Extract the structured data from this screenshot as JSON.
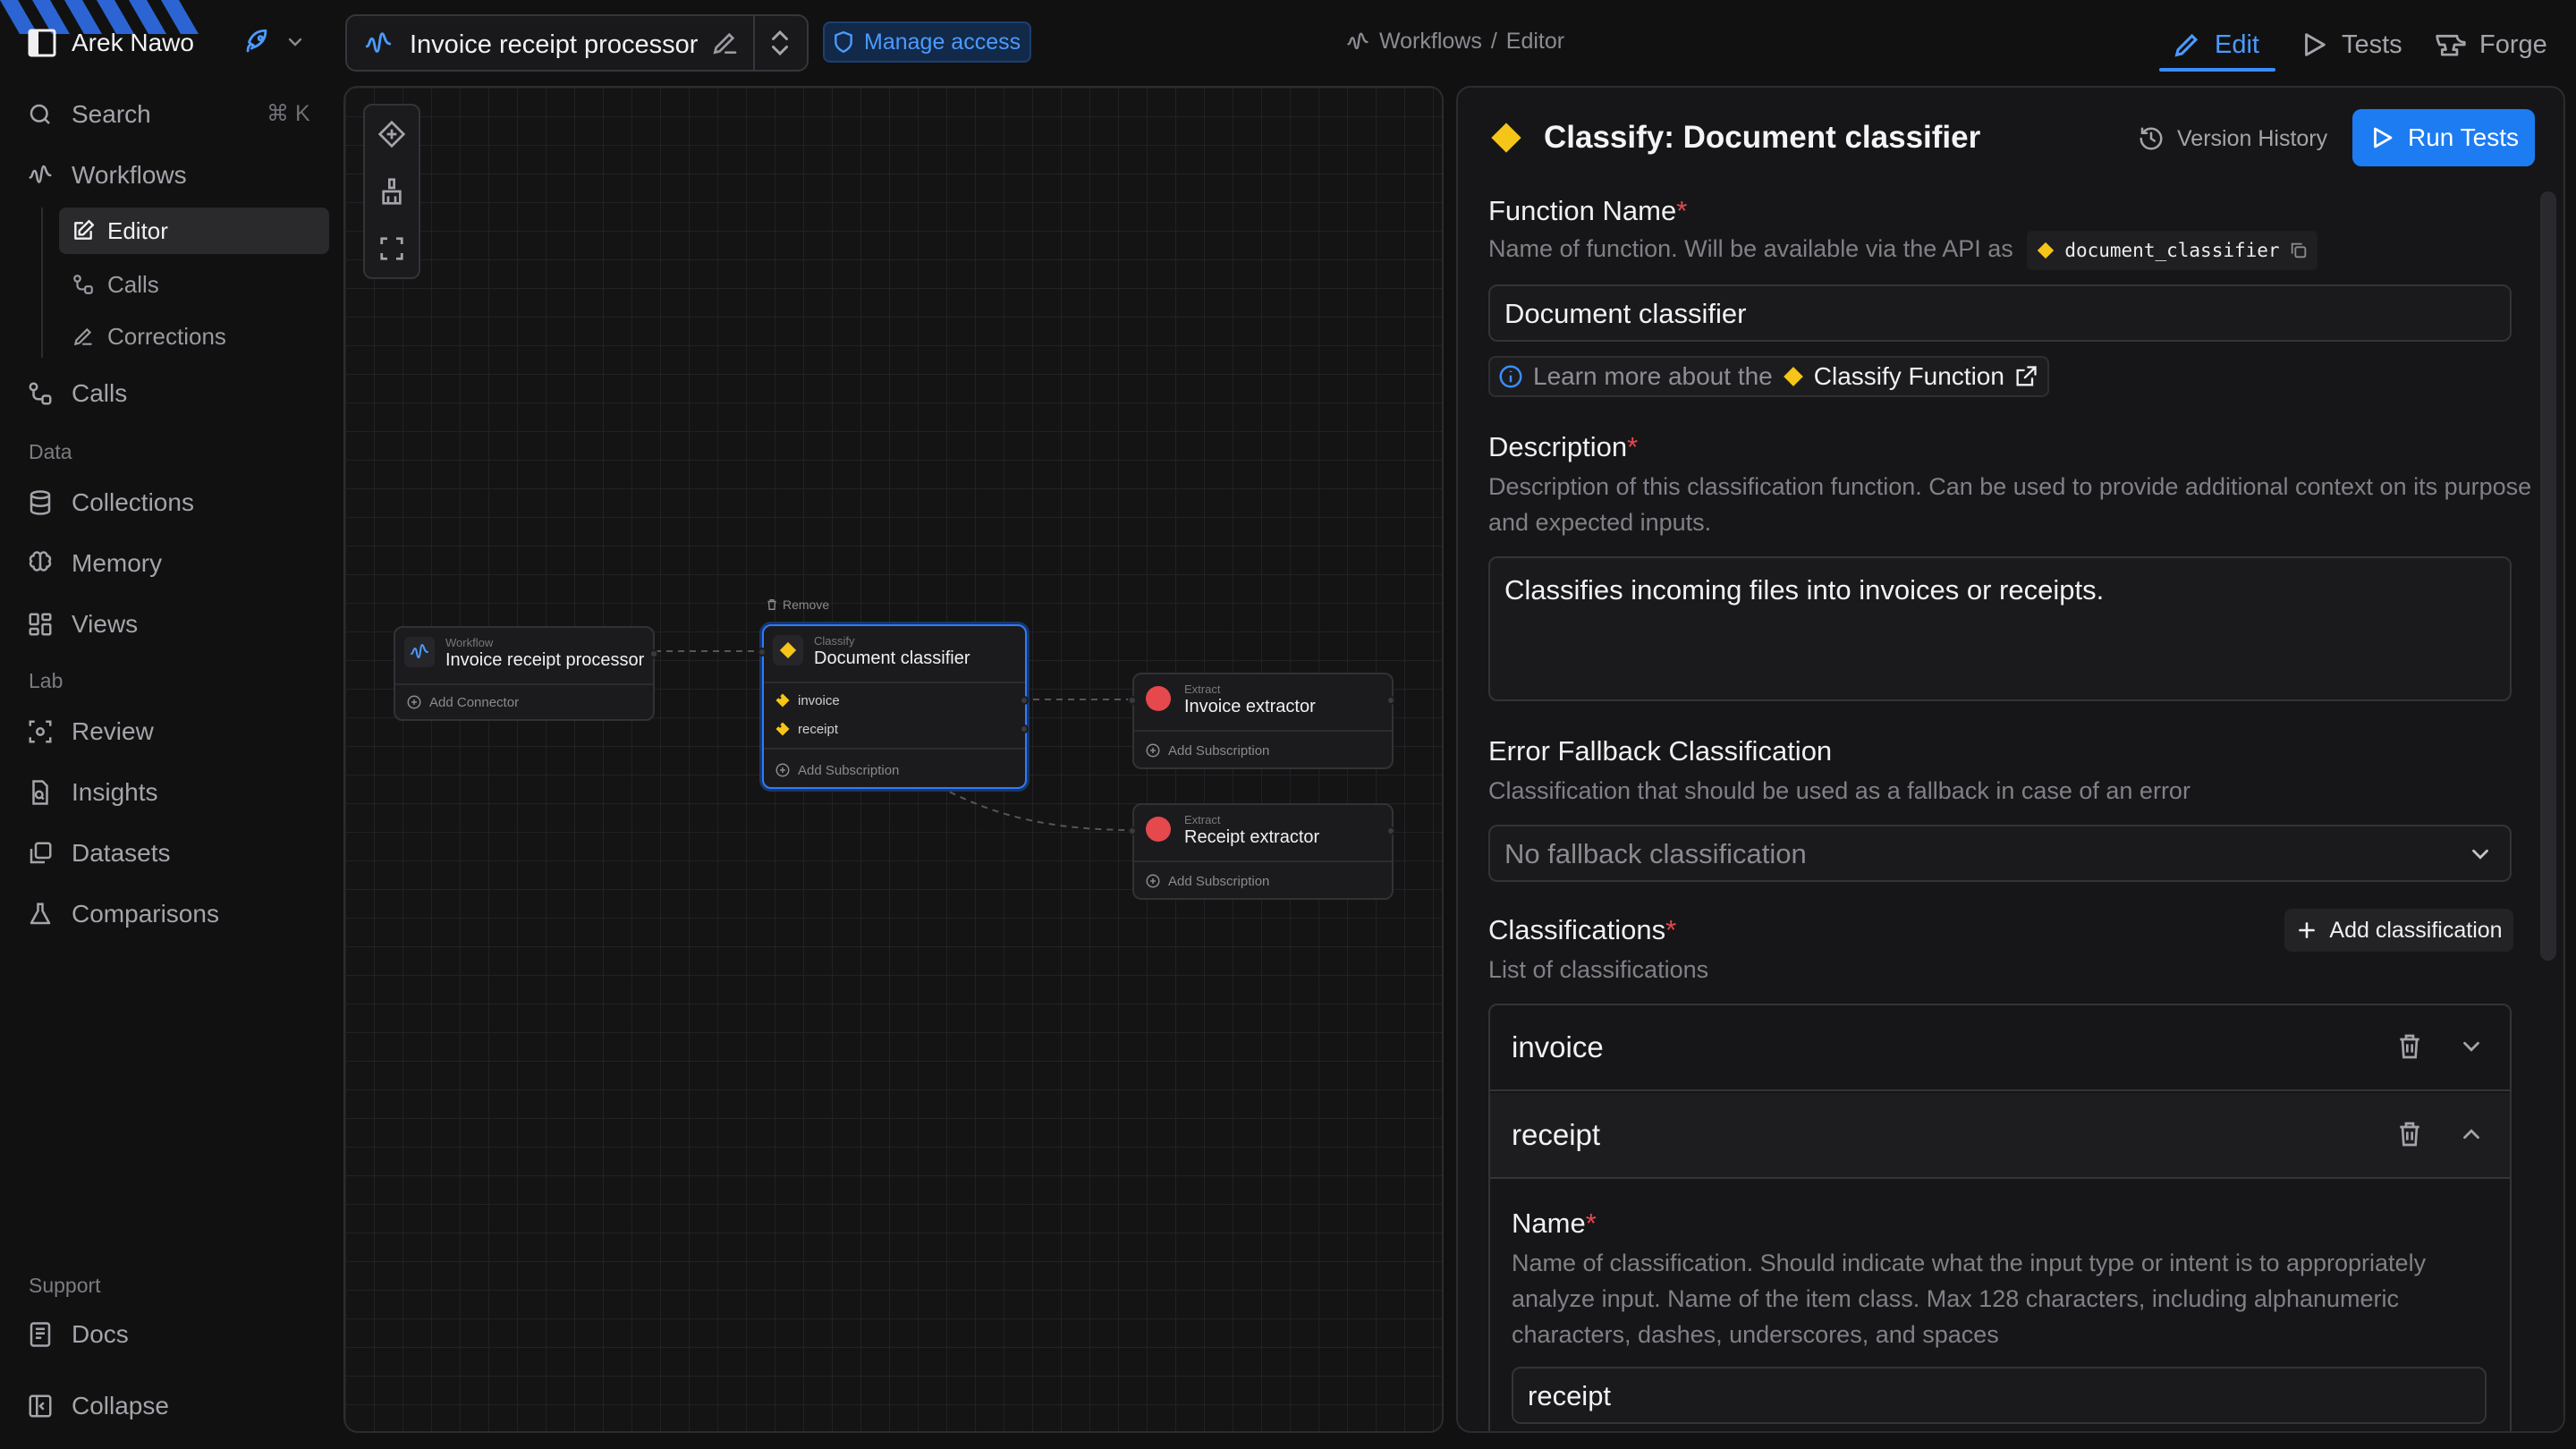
{
  "sidebar": {
    "workspace_name": "Arek Nawo",
    "search_label": "Search",
    "search_shortcut": "⌘ K",
    "workflows_label": "Workflows",
    "workflow_sub": [
      {
        "label": "Editor",
        "icon": "edit-icon"
      },
      {
        "label": "Calls",
        "icon": "calls-icon"
      },
      {
        "label": "Corrections",
        "icon": "pencil-icon"
      }
    ],
    "calls_label": "Calls",
    "data_section": "Data",
    "collections_label": "Collections",
    "memory_label": "Memory",
    "views_label": "Views",
    "lab_section": "Lab",
    "review_label": "Review",
    "insights_label": "Insights",
    "datasets_label": "Datasets",
    "comparisons_label": "Comparisons",
    "support_section": "Support",
    "docs_label": "Docs",
    "collapse_label": "Collapse"
  },
  "topbar": {
    "workflow_title": "Invoice receipt processor",
    "manage_access": "Manage access",
    "breadcrumb_1": "Workflows",
    "breadcrumb_sep": "/",
    "breadcrumb_2": "Editor",
    "tab_edit": "Edit",
    "tab_tests": "Tests",
    "tab_forge": "Forge",
    "active_tab": "Edit"
  },
  "canvas": {
    "remove_label": "Remove",
    "nodes": {
      "workflow": {
        "type": "Workflow",
        "name": "Invoice receipt processor",
        "action": "Add Connector"
      },
      "classify": {
        "type": "Classify",
        "name": "Document classifier",
        "outputs": [
          "invoice",
          "receipt"
        ],
        "action": "Add Subscription"
      },
      "invoice_extractor": {
        "type": "Extract",
        "name": "Invoice extractor",
        "action": "Add Subscription"
      },
      "receipt_extractor": {
        "type": "Extract",
        "name": "Receipt extractor",
        "action": "Add Subscription"
      }
    }
  },
  "panel": {
    "title": "Classify: Document classifier",
    "version_history": "Version History",
    "run_tests": "Run Tests",
    "function_name": {
      "label": "Function Name",
      "help": "Name of function. Will be available via the API as",
      "api_name": "document_classifier",
      "value": "Document classifier"
    },
    "learn": {
      "prefix": "Learn more about the",
      "link": "Classify Function"
    },
    "description": {
      "label": "Description",
      "help": "Description of this classification function. Can be used to provide additional context on its purpose and expected inputs.",
      "value": "Classifies incoming files into invoices or receipts."
    },
    "fallback": {
      "label": "Error Fallback Classification",
      "help": "Classification that should be used as a fallback in case of an error",
      "placeholder": "No fallback classification"
    },
    "classifications": {
      "label": "Classifications",
      "help": "List of classifications",
      "add_label": "Add classification",
      "items": [
        {
          "name": "invoice",
          "expanded": false
        },
        {
          "name": "receipt",
          "expanded": true
        }
      ],
      "detail": {
        "name_label": "Name",
        "name_help": "Name of classification. Should indicate what the input type or intent is to appropriately analyze input. Name of the item class. Max 128 characters, including alphanumeric characters, dashes, underscores, and spaces",
        "name_value": "receipt"
      }
    }
  },
  "colors": {
    "accent": "#3b8dff",
    "required": "#e5484d",
    "classify_diamond": "#f5c518",
    "extract_dot": "#e5484d",
    "background": "#111112"
  }
}
